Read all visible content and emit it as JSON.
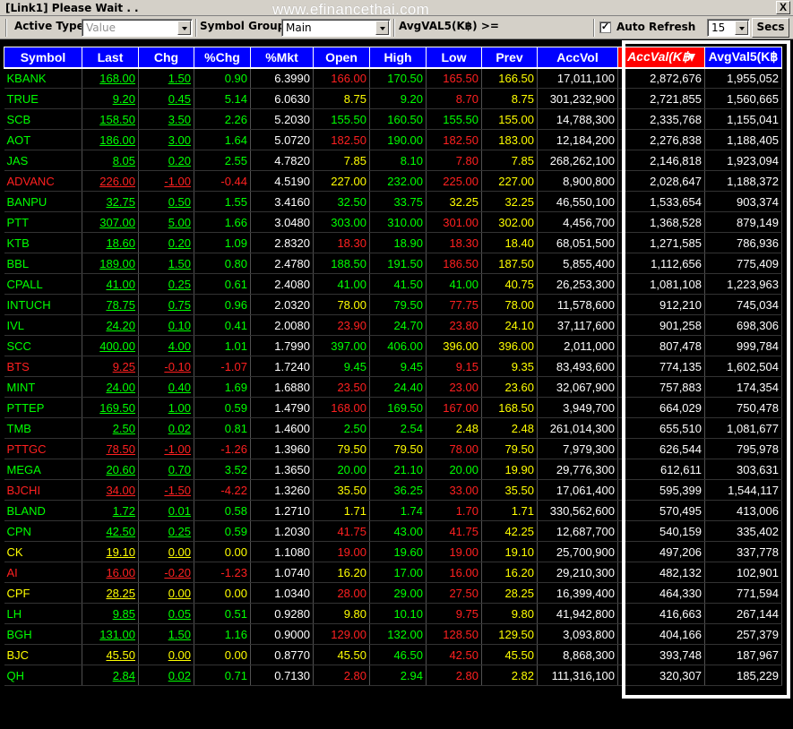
{
  "window": {
    "title": "[Link1] Please Wait . .",
    "watermark": "www.efinancethai.com",
    "close_label": "X"
  },
  "toolbar": {
    "active_type_label": "Active Type :",
    "active_type_placeholder": "Value",
    "symbol_group_label": "Symbol Group :",
    "symbol_group_value": "Main",
    "avgval_label": "AvgVAL5(K฿) >=",
    "auto_refresh_label": "Auto Refresh",
    "auto_refresh_checked": true,
    "auto_refresh_mark": "✓",
    "interval_value": "15",
    "secs_label": "Secs"
  },
  "table": {
    "headers": [
      "Symbol",
      "Last",
      "Chg",
      "%Chg",
      "%Mkt",
      "Open",
      "High",
      "Low",
      "Prev",
      "AccVol",
      "AccVal(K฿",
      "AvgVal5(K฿"
    ],
    "sorted_column": "AccVal(K฿",
    "colors": {
      "up": "#00ff00",
      "down": "#ff2020",
      "unchanged": "#ffff00",
      "neutral": "#ffffff",
      "header_bg": "#0000ff",
      "sorted_bg": "#ff0000"
    },
    "rows": [
      {
        "symbol": "KBANK",
        "last": "168.00",
        "chg": "1.50",
        "pchg": "0.90",
        "mkt": "6.3990",
        "open": "166.00",
        "high": "170.50",
        "low": "165.50",
        "prev": "166.50",
        "accvol": "17,011,100",
        "accval": "2,872,676",
        "avgval": "1,955,052",
        "c": {
          "sym": "g",
          "last": "g",
          "chg": "g",
          "pchg": "g",
          "open": "r",
          "high": "g",
          "low": "r",
          "prev": "y"
        }
      },
      {
        "symbol": "TRUE",
        "last": "9.20",
        "chg": "0.45",
        "pchg": "5.14",
        "mkt": "6.0630",
        "open": "8.75",
        "high": "9.20",
        "low": "8.70",
        "prev": "8.75",
        "accvol": "301,232,900",
        "accval": "2,721,855",
        "avgval": "1,560,665",
        "c": {
          "sym": "g",
          "last": "g",
          "chg": "g",
          "pchg": "g",
          "open": "y",
          "high": "g",
          "low": "r",
          "prev": "y"
        }
      },
      {
        "symbol": "SCB",
        "last": "158.50",
        "chg": "3.50",
        "pchg": "2.26",
        "mkt": "5.2030",
        "open": "155.50",
        "high": "160.50",
        "low": "155.50",
        "prev": "155.00",
        "accvol": "14,788,300",
        "accval": "2,335,768",
        "avgval": "1,155,041",
        "c": {
          "sym": "g",
          "last": "g",
          "chg": "g",
          "pchg": "g",
          "open": "g",
          "high": "g",
          "low": "g",
          "prev": "y"
        }
      },
      {
        "symbol": "AOT",
        "last": "186.00",
        "chg": "3.00",
        "pchg": "1.64",
        "mkt": "5.0720",
        "open": "182.50",
        "high": "190.00",
        "low": "182.50",
        "prev": "183.00",
        "accvol": "12,184,200",
        "accval": "2,276,838",
        "avgval": "1,188,405",
        "c": {
          "sym": "g",
          "last": "g",
          "chg": "g",
          "pchg": "g",
          "open": "r",
          "high": "g",
          "low": "r",
          "prev": "y"
        }
      },
      {
        "symbol": "JAS",
        "last": "8.05",
        "chg": "0.20",
        "pchg": "2.55",
        "mkt": "4.7820",
        "open": "7.85",
        "high": "8.10",
        "low": "7.80",
        "prev": "7.85",
        "accvol": "268,262,100",
        "accval": "2,146,818",
        "avgval": "1,923,094",
        "c": {
          "sym": "g",
          "last": "g",
          "chg": "g",
          "pchg": "g",
          "open": "y",
          "high": "g",
          "low": "r",
          "prev": "y"
        }
      },
      {
        "symbol": "ADVANC",
        "last": "226.00",
        "chg": "-1.00",
        "pchg": "-0.44",
        "mkt": "4.5190",
        "open": "227.00",
        "high": "232.00",
        "low": "225.00",
        "prev": "227.00",
        "accvol": "8,900,800",
        "accval": "2,028,647",
        "avgval": "1,188,372",
        "c": {
          "sym": "r",
          "last": "r",
          "chg": "r",
          "pchg": "r",
          "open": "y",
          "high": "g",
          "low": "r",
          "prev": "y"
        }
      },
      {
        "symbol": "BANPU",
        "last": "32.75",
        "chg": "0.50",
        "pchg": "1.55",
        "mkt": "3.4160",
        "open": "32.50",
        "high": "33.75",
        "low": "32.25",
        "prev": "32.25",
        "accvol": "46,550,100",
        "accval": "1,533,654",
        "avgval": "903,374",
        "c": {
          "sym": "g",
          "last": "g",
          "chg": "g",
          "pchg": "g",
          "open": "g",
          "high": "g",
          "low": "y",
          "prev": "y"
        }
      },
      {
        "symbol": "PTT",
        "last": "307.00",
        "chg": "5.00",
        "pchg": "1.66",
        "mkt": "3.0480",
        "open": "303.00",
        "high": "310.00",
        "low": "301.00",
        "prev": "302.00",
        "accvol": "4,456,700",
        "accval": "1,368,528",
        "avgval": "879,149",
        "c": {
          "sym": "g",
          "last": "g",
          "chg": "g",
          "pchg": "g",
          "open": "g",
          "high": "g",
          "low": "r",
          "prev": "y"
        }
      },
      {
        "symbol": "KTB",
        "last": "18.60",
        "chg": "0.20",
        "pchg": "1.09",
        "mkt": "2.8320",
        "open": "18.30",
        "high": "18.90",
        "low": "18.30",
        "prev": "18.40",
        "accvol": "68,051,500",
        "accval": "1,271,585",
        "avgval": "786,936",
        "c": {
          "sym": "g",
          "last": "g",
          "chg": "g",
          "pchg": "g",
          "open": "r",
          "high": "g",
          "low": "r",
          "prev": "y"
        }
      },
      {
        "symbol": "BBL",
        "last": "189.00",
        "chg": "1.50",
        "pchg": "0.80",
        "mkt": "2.4780",
        "open": "188.50",
        "high": "191.50",
        "low": "186.50",
        "prev": "187.50",
        "accvol": "5,855,400",
        "accval": "1,112,656",
        "avgval": "775,409",
        "c": {
          "sym": "g",
          "last": "g",
          "chg": "g",
          "pchg": "g",
          "open": "g",
          "high": "g",
          "low": "r",
          "prev": "y"
        }
      },
      {
        "symbol": "CPALL",
        "last": "41.00",
        "chg": "0.25",
        "pchg": "0.61",
        "mkt": "2.4080",
        "open": "41.00",
        "high": "41.50",
        "low": "41.00",
        "prev": "40.75",
        "accvol": "26,253,300",
        "accval": "1,081,108",
        "avgval": "1,223,963",
        "c": {
          "sym": "g",
          "last": "g",
          "chg": "g",
          "pchg": "g",
          "open": "g",
          "high": "g",
          "low": "g",
          "prev": "y"
        }
      },
      {
        "symbol": "INTUCH",
        "last": "78.75",
        "chg": "0.75",
        "pchg": "0.96",
        "mkt": "2.0320",
        "open": "78.00",
        "high": "79.50",
        "low": "77.75",
        "prev": "78.00",
        "accvol": "11,578,600",
        "accval": "912,210",
        "avgval": "745,034",
        "c": {
          "sym": "g",
          "last": "g",
          "chg": "g",
          "pchg": "g",
          "open": "y",
          "high": "g",
          "low": "r",
          "prev": "y"
        }
      },
      {
        "symbol": "IVL",
        "last": "24.20",
        "chg": "0.10",
        "pchg": "0.41",
        "mkt": "2.0080",
        "open": "23.90",
        "high": "24.70",
        "low": "23.80",
        "prev": "24.10",
        "accvol": "37,117,600",
        "accval": "901,258",
        "avgval": "698,306",
        "c": {
          "sym": "g",
          "last": "g",
          "chg": "g",
          "pchg": "g",
          "open": "r",
          "high": "g",
          "low": "r",
          "prev": "y"
        }
      },
      {
        "symbol": "SCC",
        "last": "400.00",
        "chg": "4.00",
        "pchg": "1.01",
        "mkt": "1.7990",
        "open": "397.00",
        "high": "406.00",
        "low": "396.00",
        "prev": "396.00",
        "accvol": "2,011,000",
        "accval": "807,478",
        "avgval": "999,784",
        "c": {
          "sym": "g",
          "last": "g",
          "chg": "g",
          "pchg": "g",
          "open": "g",
          "high": "g",
          "low": "y",
          "prev": "y"
        }
      },
      {
        "symbol": "BTS",
        "last": "9.25",
        "chg": "-0.10",
        "pchg": "-1.07",
        "mkt": "1.7240",
        "open": "9.45",
        "high": "9.45",
        "low": "9.15",
        "prev": "9.35",
        "accvol": "83,493,600",
        "accval": "774,135",
        "avgval": "1,602,504",
        "c": {
          "sym": "r",
          "last": "r",
          "chg": "r",
          "pchg": "r",
          "open": "g",
          "high": "g",
          "low": "r",
          "prev": "y"
        }
      },
      {
        "symbol": "MINT",
        "last": "24.00",
        "chg": "0.40",
        "pchg": "1.69",
        "mkt": "1.6880",
        "open": "23.50",
        "high": "24.40",
        "low": "23.00",
        "prev": "23.60",
        "accvol": "32,067,900",
        "accval": "757,883",
        "avgval": "174,354",
        "c": {
          "sym": "g",
          "last": "g",
          "chg": "g",
          "pchg": "g",
          "open": "r",
          "high": "g",
          "low": "r",
          "prev": "y"
        }
      },
      {
        "symbol": "PTTEP",
        "last": "169.50",
        "chg": "1.00",
        "pchg": "0.59",
        "mkt": "1.4790",
        "open": "168.00",
        "high": "169.50",
        "low": "167.00",
        "prev": "168.50",
        "accvol": "3,949,700",
        "accval": "664,029",
        "avgval": "750,478",
        "c": {
          "sym": "g",
          "last": "g",
          "chg": "g",
          "pchg": "g",
          "open": "r",
          "high": "g",
          "low": "r",
          "prev": "y"
        }
      },
      {
        "symbol": "TMB",
        "last": "2.50",
        "chg": "0.02",
        "pchg": "0.81",
        "mkt": "1.4600",
        "open": "2.50",
        "high": "2.54",
        "low": "2.48",
        "prev": "2.48",
        "accvol": "261,014,300",
        "accval": "655,510",
        "avgval": "1,081,677",
        "c": {
          "sym": "g",
          "last": "g",
          "chg": "g",
          "pchg": "g",
          "open": "g",
          "high": "g",
          "low": "y",
          "prev": "y"
        }
      },
      {
        "symbol": "PTTGC",
        "last": "78.50",
        "chg": "-1.00",
        "pchg": "-1.26",
        "mkt": "1.3960",
        "open": "79.50",
        "high": "79.50",
        "low": "78.00",
        "prev": "79.50",
        "accvol": "7,979,300",
        "accval": "626,544",
        "avgval": "795,978",
        "c": {
          "sym": "r",
          "last": "r",
          "chg": "r",
          "pchg": "r",
          "open": "y",
          "high": "y",
          "low": "r",
          "prev": "y"
        }
      },
      {
        "symbol": "MEGA",
        "last": "20.60",
        "chg": "0.70",
        "pchg": "3.52",
        "mkt": "1.3650",
        "open": "20.00",
        "high": "21.10",
        "low": "20.00",
        "prev": "19.90",
        "accvol": "29,776,300",
        "accval": "612,611",
        "avgval": "303,631",
        "c": {
          "sym": "g",
          "last": "g",
          "chg": "g",
          "pchg": "g",
          "open": "g",
          "high": "g",
          "low": "g",
          "prev": "y"
        }
      },
      {
        "symbol": "BJCHI",
        "last": "34.00",
        "chg": "-1.50",
        "pchg": "-4.22",
        "mkt": "1.3260",
        "open": "35.50",
        "high": "36.25",
        "low": "33.00",
        "prev": "35.50",
        "accvol": "17,061,400",
        "accval": "595,399",
        "avgval": "1,544,117",
        "c": {
          "sym": "r",
          "last": "r",
          "chg": "r",
          "pchg": "r",
          "open": "y",
          "high": "g",
          "low": "r",
          "prev": "y"
        }
      },
      {
        "symbol": "BLAND",
        "last": "1.72",
        "chg": "0.01",
        "pchg": "0.58",
        "mkt": "1.2710",
        "open": "1.71",
        "high": "1.74",
        "low": "1.70",
        "prev": "1.71",
        "accvol": "330,562,600",
        "accval": "570,495",
        "avgval": "413,006",
        "c": {
          "sym": "g",
          "last": "g",
          "chg": "g",
          "pchg": "g",
          "open": "y",
          "high": "g",
          "low": "r",
          "prev": "y"
        }
      },
      {
        "symbol": "CPN",
        "last": "42.50",
        "chg": "0.25",
        "pchg": "0.59",
        "mkt": "1.2030",
        "open": "41.75",
        "high": "43.00",
        "low": "41.75",
        "prev": "42.25",
        "accvol": "12,687,700",
        "accval": "540,159",
        "avgval": "335,402",
        "c": {
          "sym": "g",
          "last": "g",
          "chg": "g",
          "pchg": "g",
          "open": "r",
          "high": "g",
          "low": "r",
          "prev": "y"
        }
      },
      {
        "symbol": "CK",
        "last": "19.10",
        "chg": "0.00",
        "pchg": "0.00",
        "mkt": "1.1080",
        "open": "19.00",
        "high": "19.60",
        "low": "19.00",
        "prev": "19.10",
        "accvol": "25,700,900",
        "accval": "497,206",
        "avgval": "337,778",
        "c": {
          "sym": "y",
          "last": "y",
          "chg": "y",
          "pchg": "y",
          "open": "r",
          "high": "g",
          "low": "r",
          "prev": "y"
        }
      },
      {
        "symbol": "AI",
        "last": "16.00",
        "chg": "-0.20",
        "pchg": "-1.23",
        "mkt": "1.0740",
        "open": "16.20",
        "high": "17.00",
        "low": "16.00",
        "prev": "16.20",
        "accvol": "29,210,300",
        "accval": "482,132",
        "avgval": "102,901",
        "c": {
          "sym": "r",
          "last": "r",
          "chg": "r",
          "pchg": "r",
          "open": "y",
          "high": "g",
          "low": "r",
          "prev": "y"
        }
      },
      {
        "symbol": "CPF",
        "last": "28.25",
        "chg": "0.00",
        "pchg": "0.00",
        "mkt": "1.0340",
        "open": "28.00",
        "high": "29.00",
        "low": "27.50",
        "prev": "28.25",
        "accvol": "16,399,400",
        "accval": "464,330",
        "avgval": "771,594",
        "c": {
          "sym": "y",
          "last": "y",
          "chg": "y",
          "pchg": "y",
          "open": "r",
          "high": "g",
          "low": "r",
          "prev": "y"
        }
      },
      {
        "symbol": "LH",
        "last": "9.85",
        "chg": "0.05",
        "pchg": "0.51",
        "mkt": "0.9280",
        "open": "9.80",
        "high": "10.10",
        "low": "9.75",
        "prev": "9.80",
        "accvol": "41,942,800",
        "accval": "416,663",
        "avgval": "267,144",
        "c": {
          "sym": "g",
          "last": "g",
          "chg": "g",
          "pchg": "g",
          "open": "y",
          "high": "g",
          "low": "r",
          "prev": "y"
        }
      },
      {
        "symbol": "BGH",
        "last": "131.00",
        "chg": "1.50",
        "pchg": "1.16",
        "mkt": "0.9000",
        "open": "129.00",
        "high": "132.00",
        "low": "128.50",
        "prev": "129.50",
        "accvol": "3,093,800",
        "accval": "404,166",
        "avgval": "257,379",
        "c": {
          "sym": "g",
          "last": "g",
          "chg": "g",
          "pchg": "g",
          "open": "r",
          "high": "g",
          "low": "r",
          "prev": "y"
        }
      },
      {
        "symbol": "BJC",
        "last": "45.50",
        "chg": "0.00",
        "pchg": "0.00",
        "mkt": "0.8770",
        "open": "45.50",
        "high": "46.50",
        "low": "42.50",
        "prev": "45.50",
        "accvol": "8,868,300",
        "accval": "393,748",
        "avgval": "187,967",
        "c": {
          "sym": "y",
          "last": "y",
          "chg": "y",
          "pchg": "y",
          "open": "y",
          "high": "g",
          "low": "r",
          "prev": "y"
        }
      },
      {
        "symbol": "QH",
        "last": "2.84",
        "chg": "0.02",
        "pchg": "0.71",
        "mkt": "0.7130",
        "open": "2.80",
        "high": "2.94",
        "low": "2.80",
        "prev": "2.82",
        "accvol": "111,316,100",
        "accval": "320,307",
        "avgval": "185,229",
        "c": {
          "sym": "g",
          "last": "g",
          "chg": "g",
          "pchg": "g",
          "open": "r",
          "high": "g",
          "low": "r",
          "prev": "y"
        }
      }
    ]
  }
}
